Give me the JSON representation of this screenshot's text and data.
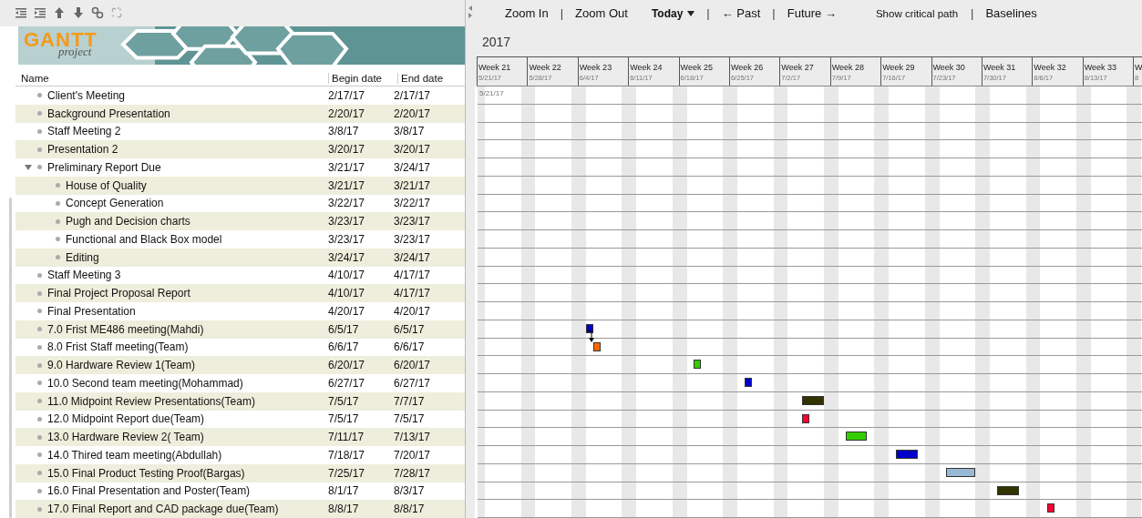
{
  "task_toolbar": {
    "buttons": [
      {
        "kind": "outdent"
      },
      {
        "kind": "indent"
      },
      {
        "kind": "up"
      },
      {
        "kind": "down"
      },
      {
        "kind": "link"
      },
      {
        "kind": "unlink"
      }
    ]
  },
  "logo": {
    "title": "GANTT",
    "subtitle": "project"
  },
  "table": {
    "columns": [
      "Name",
      "Begin date",
      "End date"
    ],
    "tasks": [
      {
        "name": "Client's Meeting",
        "begin": "2/17/17",
        "end": "2/17/17"
      },
      {
        "name": "Background Presentation",
        "begin": "2/20/17",
        "end": "2/20/17"
      },
      {
        "name": "Staff Meeting 2",
        "begin": "3/8/17",
        "end": "3/8/17"
      },
      {
        "name": "Presentation 2",
        "begin": "3/20/17",
        "end": "3/20/17"
      },
      {
        "name": "Preliminary Report Due",
        "begin": "3/21/17",
        "end": "3/24/17",
        "expanded": true,
        "children": [
          {
            "name": "House of Quality",
            "begin": "3/21/17",
            "end": "3/21/17"
          },
          {
            "name": "Concept Generation",
            "begin": "3/22/17",
            "end": "3/22/17"
          },
          {
            "name": "Pugh and Decision charts",
            "begin": "3/23/17",
            "end": "3/23/17"
          },
          {
            "name": "Functional and Black Box model",
            "begin": "3/23/17",
            "end": "3/23/17"
          },
          {
            "name": "Editing",
            "begin": "3/24/17",
            "end": "3/24/17"
          }
        ]
      },
      {
        "name": "Staff Meeting 3",
        "begin": "4/10/17",
        "end": "4/17/17"
      },
      {
        "name": "Final Project Proposal Report",
        "begin": "4/10/17",
        "end": "4/17/17"
      },
      {
        "name": "Final Presentation",
        "begin": "4/20/17",
        "end": "4/20/17"
      },
      {
        "name": "7.0 Frist ME486 meeting(Mahdi)",
        "begin": "6/5/17",
        "end": "6/5/17",
        "color": "#0000cc"
      },
      {
        "name": "8.0 Frist Staff meeting(Team)",
        "begin": "6/6/17",
        "end": "6/6/17",
        "color": "#ff6600",
        "linked_to_previous": true
      },
      {
        "name": "9.0 Hardware Review 1(Team)",
        "begin": "6/20/17",
        "end": "6/20/17",
        "color": "#33cc00"
      },
      {
        "name": "10.0 Second team meeting(Mohammad)",
        "begin": "6/27/17",
        "end": "6/27/17",
        "color": "#0000cc"
      },
      {
        "name": "11.0 Midpoint Review Presentations(Team)",
        "begin": "7/5/17",
        "end": "7/7/17",
        "color": "#333300"
      },
      {
        "name": "12.0 Midpoint Report due(Team)",
        "begin": "7/5/17",
        "end": "7/5/17",
        "color": "#ff0033"
      },
      {
        "name": "13.0 Hardware Review 2( Team)",
        "begin": "7/11/17",
        "end": "7/13/17",
        "color": "#33cc00"
      },
      {
        "name": "14.0 Thired team meeting(Abdullah)",
        "begin": "7/18/17",
        "end": "7/20/17",
        "color": "#0000cc"
      },
      {
        "name": "15.0 Final Product Testing Proof(Bargas)",
        "begin": "7/25/17",
        "end": "7/28/17",
        "color": "#99b8d4"
      },
      {
        "name": "16.0 Final Presentation and Poster(Team)",
        "begin": "8/1/17",
        "end": "8/3/17",
        "color": "#333300"
      },
      {
        "name": "17.0 Final Report and CAD package due(Team)",
        "begin": "8/8/17",
        "end": "8/8/17",
        "color": "#ff0033"
      }
    ]
  },
  "chart_toolbar": {
    "items": [
      {
        "kind": "button",
        "label": "Zoom In"
      },
      {
        "kind": "separator",
        "label": "|"
      },
      {
        "kind": "button",
        "label": "Zoom Out"
      },
      {
        "kind": "dropdown",
        "label": "Today"
      },
      {
        "kind": "separator",
        "label": "|"
      },
      {
        "kind": "button",
        "label": "← Past"
      },
      {
        "kind": "separator",
        "label": "|"
      },
      {
        "kind": "button",
        "label": "Future →"
      },
      {
        "kind": "small",
        "label": "Show critical path"
      },
      {
        "kind": "separator",
        "label": "|"
      },
      {
        "kind": "button",
        "label": "Baselines"
      }
    ]
  },
  "chart": {
    "year": "2017",
    "start_marker": "5/21/17",
    "weeks": [
      {
        "label": "Week 21",
        "date": "5/21/17"
      },
      {
        "label": "Week 22",
        "date": "5/28/17"
      },
      {
        "label": "Week 23",
        "date": "6/4/17"
      },
      {
        "label": "Week 24",
        "date": "6/11/17"
      },
      {
        "label": "Week 25",
        "date": "6/18/17"
      },
      {
        "label": "Week 26",
        "date": "6/25/17"
      },
      {
        "label": "Week 27",
        "date": "7/2/17"
      },
      {
        "label": "Week 28",
        "date": "7/9/17"
      },
      {
        "label": "Week 29",
        "date": "7/16/17"
      },
      {
        "label": "Week 30",
        "date": "7/23/17"
      },
      {
        "label": "Week 31",
        "date": "7/30/17"
      },
      {
        "label": "Week 32",
        "date": "8/6/17"
      },
      {
        "label": "Week 33",
        "date": "8/13/17"
      },
      {
        "label": "W",
        "date": "8"
      }
    ]
  }
}
